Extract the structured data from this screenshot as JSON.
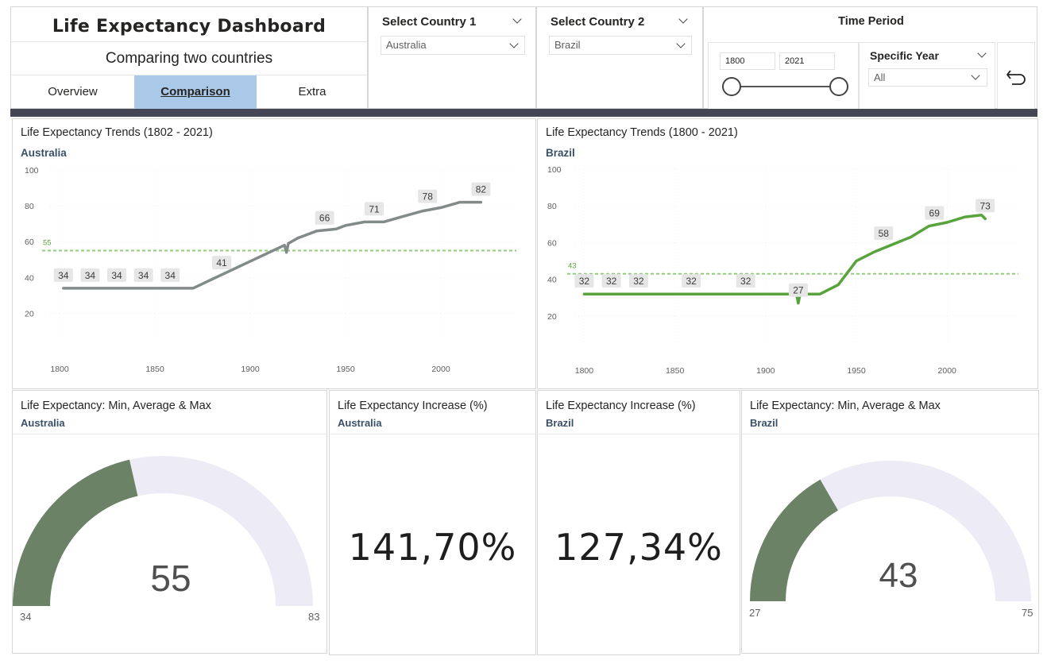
{
  "header": {
    "title": "Life Expectancy Dashboard",
    "subtitle": "Comparing two countries",
    "tabs": [
      {
        "label": "Overview",
        "active": false
      },
      {
        "label": "Comparison",
        "active": true
      },
      {
        "label": "Extra",
        "active": false
      }
    ]
  },
  "slicers": {
    "country1": {
      "title": "Select Country 1",
      "value": "Australia"
    },
    "country2": {
      "title": "Select Country 2",
      "value": "Brazil"
    },
    "time_period": {
      "title": "Time Period",
      "start": "1800",
      "end": "2021"
    },
    "specific_year": {
      "title": "Specific Year",
      "value": "All"
    },
    "back_icon": "back-arrow-icon"
  },
  "colors": {
    "accent_bar": "#444656",
    "active_tab": "#aac8e8",
    "australia_line": "#838a8a",
    "brazil_line": "#58a33c",
    "avg_line": "#8fce7a",
    "gauge_fill": "#6b8266",
    "gauge_track": "#ecebf6",
    "country_label": "#3a5068"
  },
  "trend_charts": [
    {
      "title": "Life Expectancy Trends (1802 - 2021)",
      "country": "Australia",
      "avg_label": "55",
      "chart_data": {
        "type": "line",
        "x_ticks": [
          "1800",
          "1850",
          "1900",
          "1950",
          "2000"
        ],
        "y_ticks": [
          "100",
          "80",
          "60",
          "40",
          "20"
        ],
        "ylim": [
          10,
          100
        ],
        "xlim": [
          1795,
          2045
        ],
        "average": 55,
        "points": [
          [
            1802,
            34
          ],
          [
            1870,
            34
          ],
          [
            1918,
            58
          ],
          [
            1919,
            54
          ],
          [
            1920,
            59
          ],
          [
            1925,
            62
          ],
          [
            1935,
            66
          ],
          [
            1945,
            67
          ],
          [
            1950,
            69
          ],
          [
            1960,
            71
          ],
          [
            1970,
            71
          ],
          [
            1980,
            74
          ],
          [
            1990,
            77
          ],
          [
            2000,
            79
          ],
          [
            2010,
            82
          ],
          [
            2021,
            82
          ]
        ],
        "data_labels": [
          {
            "x": 1802,
            "y": 34,
            "text": "34"
          },
          {
            "x": 1816,
            "y": 34,
            "text": "34"
          },
          {
            "x": 1830,
            "y": 34,
            "text": "34"
          },
          {
            "x": 1844,
            "y": 34,
            "text": "34"
          },
          {
            "x": 1858,
            "y": 34,
            "text": "34"
          },
          {
            "x": 1885,
            "y": 41,
            "text": "41"
          },
          {
            "x": 1939,
            "y": 66,
            "text": "66"
          },
          {
            "x": 1965,
            "y": 71,
            "text": "71"
          },
          {
            "x": 1993,
            "y": 78,
            "text": "78"
          },
          {
            "x": 2021,
            "y": 82,
            "text": "82"
          }
        ]
      }
    },
    {
      "title": "Life Expectancy Trends (1800 - 2021)",
      "country": "Brazil",
      "avg_label": "43",
      "chart_data": {
        "type": "line",
        "x_ticks": [
          "1800",
          "1850",
          "1900",
          "1950",
          "2000"
        ],
        "y_ticks": [
          "100",
          "80",
          "60",
          "40",
          "20"
        ],
        "ylim": [
          10,
          100
        ],
        "xlim": [
          1795,
          2045
        ],
        "average": 43,
        "points": [
          [
            1800,
            32
          ],
          [
            1917,
            32
          ],
          [
            1918,
            27
          ],
          [
            1919,
            32
          ],
          [
            1930,
            32
          ],
          [
            1940,
            37
          ],
          [
            1950,
            50
          ],
          [
            1960,
            55
          ],
          [
            1970,
            59
          ],
          [
            1980,
            63
          ],
          [
            1990,
            69
          ],
          [
            2000,
            71
          ],
          [
            2010,
            74
          ],
          [
            2019,
            75
          ],
          [
            2021,
            73
          ]
        ],
        "data_labels": [
          {
            "x": 1800,
            "y": 32,
            "text": "32"
          },
          {
            "x": 1815,
            "y": 32,
            "text": "32"
          },
          {
            "x": 1830,
            "y": 32,
            "text": "32"
          },
          {
            "x": 1859,
            "y": 32,
            "text": "32"
          },
          {
            "x": 1889,
            "y": 32,
            "text": "32"
          },
          {
            "x": 1918,
            "y": 27,
            "text": "27"
          },
          {
            "x": 1965,
            "y": 58,
            "text": "58"
          },
          {
            "x": 1993,
            "y": 69,
            "text": "69"
          },
          {
            "x": 2021,
            "y": 73,
            "text": "73"
          }
        ]
      }
    }
  ],
  "gauges": [
    {
      "title": "Life Expectancy: Min, Average & Max",
      "country": "Australia",
      "min": 34,
      "value": 55,
      "max": 83,
      "min_label": "34",
      "value_label": "55",
      "max_label": "83"
    },
    {
      "title": "Life Expectancy: Min, Average & Max",
      "country": "Brazil",
      "min": 27,
      "value": 43,
      "max": 75,
      "min_label": "27",
      "value_label": "43",
      "max_label": "75"
    }
  ],
  "kpis": [
    {
      "title": "Life Expectancy Increase (%)",
      "country": "Australia",
      "value": "141,70%"
    },
    {
      "title": "Life Expectancy Increase (%)",
      "country": "Brazil",
      "value": "127,34%"
    }
  ]
}
